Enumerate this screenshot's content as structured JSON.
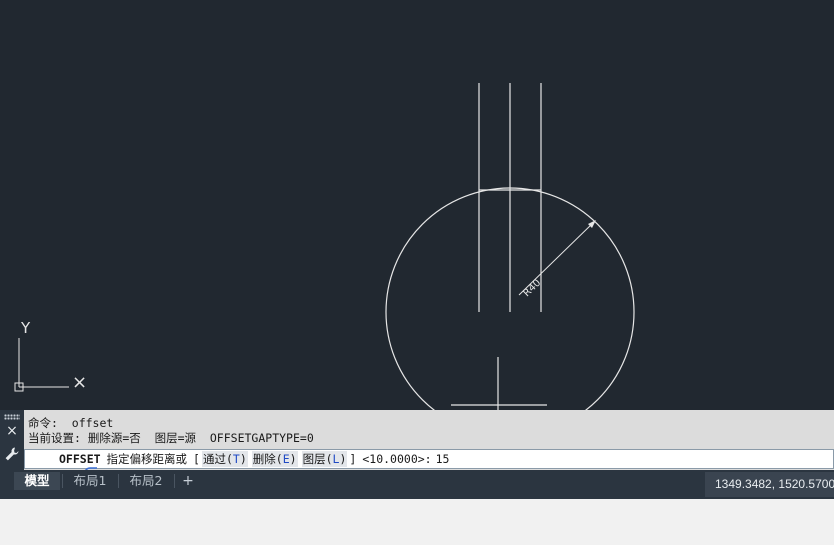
{
  "drawing": {
    "ucs_y_label": "Y",
    "ucs_x_label": "×",
    "dimension_label": "R40",
    "colors": {
      "background": "#212830",
      "geometry": "#e6e6e6"
    }
  },
  "command_window": {
    "history": [
      "命令:  offset",
      "当前设置: 删除源=否  图层=源  OFFSETGAPTYPE=0"
    ],
    "close_icon": "×",
    "prompt": {
      "command_name": "OFFSET",
      "text": "指定偏移距离或",
      "bracket_open": "[",
      "options": [
        {
          "label": "通过(",
          "key": "T",
          "close": ")"
        },
        {
          "label": "删除(",
          "key": "E",
          "close": ")"
        },
        {
          "label": "图层(",
          "key": "L",
          "close": ")"
        }
      ],
      "bracket_close": "]",
      "default_value": "<10.0000>:",
      "input_value": "15"
    }
  },
  "status_bar": {
    "tabs": [
      {
        "label": "模型",
        "active": true
      },
      {
        "label": "布局1",
        "active": false
      },
      {
        "label": "布局2",
        "active": false
      }
    ],
    "add_label": "+",
    "coordinates": "1349.3482, 1520.5700"
  }
}
